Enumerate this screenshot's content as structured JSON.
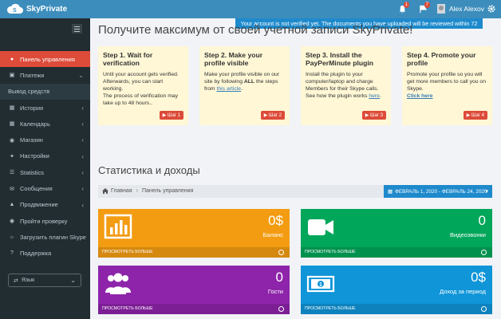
{
  "header": {
    "brand": "SkyPrivate",
    "notifications": {
      "mail_count": "1",
      "alerts_count": "7"
    },
    "user_name": "Alex Alexov",
    "notice": "Your account is not verified yet. The documents you have uploaded will be reviewed within 72 hours."
  },
  "sidebar": {
    "items": [
      {
        "label": "Панель управления",
        "icon": "home-icon",
        "active": true
      },
      {
        "label": "Платежи",
        "icon": "wallet-icon",
        "chevron": "down"
      },
      {
        "label": "Вывод средств",
        "icon": "",
        "sub": true
      },
      {
        "label": "История",
        "icon": "calendar-icon",
        "chevron": "left"
      },
      {
        "label": "Календарь",
        "icon": "grid-icon",
        "chevron": "left"
      },
      {
        "label": "Магазин",
        "icon": "store-icon",
        "chevron": "left"
      },
      {
        "label": "Настройки",
        "icon": "wrench-icon",
        "chevron": "left"
      },
      {
        "label": "Statistics",
        "icon": "list-icon",
        "chevron": "left"
      },
      {
        "label": "Сообщения",
        "icon": "envelope-icon",
        "chevron": "left"
      },
      {
        "label": "Продвижение",
        "icon": "megaphone-icon",
        "chevron": "left"
      },
      {
        "label": "Пройти проверку",
        "icon": "camera-icon"
      },
      {
        "label": "Загрузить плагин Skype",
        "icon": "skype-icon"
      },
      {
        "label": "Поддержка",
        "icon": "question-icon"
      }
    ],
    "language_label": "Язык"
  },
  "main": {
    "headline": "Получите максимум от своей учетной записи SkyPrivate!",
    "steps": [
      {
        "title": "Step 1. Wait for verification",
        "body": "Until your account gets verified. Afterwards, you can start working.",
        "body2": "The process of verification may take up to 48 hours..",
        "button": "Шаг 1"
      },
      {
        "title": "Step 2. Make your profile visible",
        "body_pre": "Make your profile visible on our site by following ",
        "body_bold": "ALL",
        "body_mid": " the steps from ",
        "body_link": "this article",
        "body_post": ".",
        "button": "Шаг 2"
      },
      {
        "title": "Step 3. Install the PayPerMinute plugin",
        "body": "Install the plugin to your computer/laptop and charge Members for their Skype calls. See how the plugin works ",
        "body_link": "here",
        "body_post": ".",
        "button": "Шаг 3"
      },
      {
        "title": "Step 4. Promote your profile",
        "body": "Promote your profile so you will get more members to call you on Skype.",
        "body_link": "Click here",
        "button": "Шаг 4"
      }
    ],
    "stats_title": "Статистика и доходы",
    "breadcrumb": {
      "home": "Главная",
      "current": "Панель управления"
    },
    "date_range": "ФЕВРАЛЬ 1, 2020 - ФЕВРАЛЬ 24, 2020",
    "tiles": [
      {
        "value": "0$",
        "label": "Баланс",
        "footer": "ПРОСМОТРЕТЬ БОЛЬШЕ",
        "color": "#f39c12",
        "icon": "chart-icon"
      },
      {
        "value": "0",
        "label": "Видеозвонки",
        "footer": "ПРОСМОТРЕТЬ БОЛЬШЕ",
        "color": "#00a65a",
        "icon": "video-camera-icon"
      },
      {
        "value": "0",
        "label": "Гости",
        "footer": "ПРОСМОТРЕТЬ БОЛЬШЕ",
        "color": "#8e24aa",
        "icon": "users-icon"
      },
      {
        "value": "0$",
        "label": "Доход за период",
        "footer": "ПРОСМОТРЕТЬ БОЛЬШЕ",
        "color": "#0f95d8",
        "icon": "money-icon"
      }
    ]
  }
}
